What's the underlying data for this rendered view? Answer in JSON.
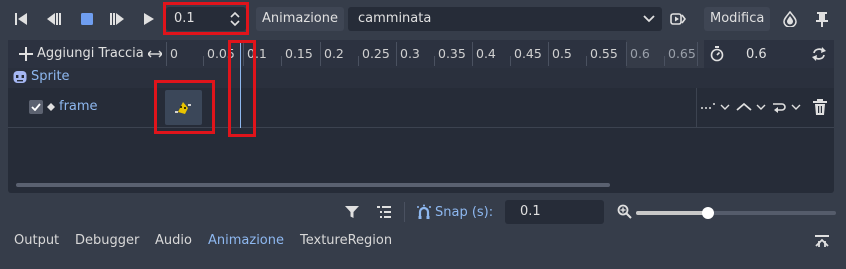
{
  "toolbar": {
    "playback": [
      "play-backward-icon",
      "step-backward-icon",
      "stop-icon",
      "step-forward-icon",
      "play-icon"
    ],
    "current_time": "0.1",
    "animation_label": "Animazione",
    "animation_selected": "camminata",
    "edit_label": "Modifica"
  },
  "timeline": {
    "add_track_label": "Aggiungi Traccia",
    "ticks": [
      "0",
      "0.05",
      "0.1",
      "0.15",
      "0.2",
      "0.25",
      "0.3",
      "0.35",
      "0.4",
      "0.45",
      "0.5",
      "0.55",
      "0.6",
      "0.65"
    ],
    "length_value": "0.6",
    "track_group_name": "Sprite",
    "track_property": "frame"
  },
  "bottom_bar": {
    "snap_label": "Snap (s):",
    "snap_value": "0.1",
    "zoom_level": 0.56
  },
  "tabs": [
    "Output",
    "Debugger",
    "Audio",
    "Animazione",
    "TextureRegion"
  ],
  "active_tab": "Animazione",
  "colors": {
    "accent": "#8eb8f0",
    "panel": "#262c38",
    "background": "#363d4a",
    "highlight": "#e0141b"
  }
}
